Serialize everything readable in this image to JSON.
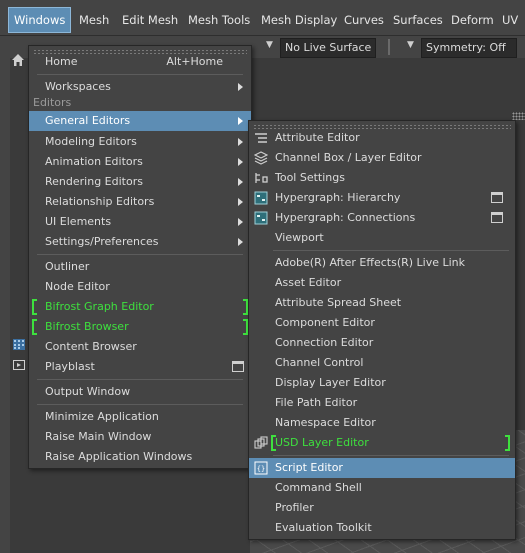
{
  "menubar": {
    "items": [
      "Windows",
      "Mesh",
      "Edit Mesh",
      "Mesh Tools",
      "Mesh Display",
      "Curves",
      "Surfaces",
      "Deform",
      "UV"
    ]
  },
  "toolbar": {
    "live_surface": "No Live Surface",
    "symmetry": "Symmetry: Off"
  },
  "windows_menu": {
    "home": "Home",
    "home_shortcut": "Alt+Home",
    "workspaces": "Workspaces",
    "editors_section": "Editors",
    "general_editors": "General Editors",
    "modeling_editors": "Modeling Editors",
    "animation_editors": "Animation Editors",
    "rendering_editors": "Rendering Editors",
    "relationship_editors": "Relationship Editors",
    "ui_elements": "UI Elements",
    "settings_preferences": "Settings/Preferences",
    "outliner": "Outliner",
    "node_editor": "Node Editor",
    "bifrost_graph_editor": "Bifrost Graph Editor",
    "bifrost_browser": "Bifrost Browser",
    "content_browser": "Content Browser",
    "playblast": "Playblast",
    "output_window": "Output Window",
    "minimize_application": "Minimize Application",
    "raise_main_window": "Raise Main Window",
    "raise_application_windows": "Raise Application Windows"
  },
  "general_editors_menu": {
    "attribute_editor": "Attribute Editor",
    "channel_box": "Channel Box / Layer Editor",
    "tool_settings": "Tool Settings",
    "hypergraph_hierarchy": "Hypergraph: Hierarchy",
    "hypergraph_connections": "Hypergraph: Connections",
    "viewport": "Viewport",
    "after_effects_live_link": "Adobe(R) After Effects(R) Live Link",
    "asset_editor": "Asset Editor",
    "attribute_spread_sheet": "Attribute Spread Sheet",
    "component_editor": "Component Editor",
    "connection_editor": "Connection Editor",
    "channel_control": "Channel Control",
    "display_layer_editor": "Display Layer Editor",
    "file_path_editor": "File Path Editor",
    "namespace_editor": "Namespace Editor",
    "usd_layer_editor": "USD Layer Editor",
    "script_editor": "Script Editor",
    "command_shell": "Command Shell",
    "profiler": "Profiler",
    "evaluation_toolkit": "Evaluation Toolkit"
  },
  "colors": {
    "highlight": "#5d8db4",
    "plugin_green": "#3ee03e",
    "menu_bg": "#444444"
  }
}
